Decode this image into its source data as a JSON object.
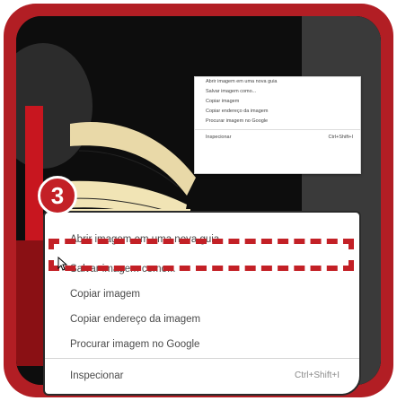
{
  "step_number": "3",
  "small_menu": {
    "items": [
      "Abrir imagem em uma nova guia",
      "Salvar imagem como...",
      "Copiar imagem",
      "Copiar endereço da imagem",
      "Procurar imagem no Google"
    ],
    "inspect_label": "Inspecionar",
    "inspect_shortcut": "Ctrl+Shift+I"
  },
  "big_menu": {
    "items": [
      "Abrir imagem em uma nova guia",
      "Salvar imagem como...",
      "Copiar imagem",
      "Copiar endereço da imagem",
      "Procurar imagem no Google"
    ],
    "inspect_label": "Inspecionar",
    "inspect_shortcut": "Ctrl+Shift+I"
  },
  "colors": {
    "accent_red": "#c32026",
    "border_red": "#b21e24"
  }
}
